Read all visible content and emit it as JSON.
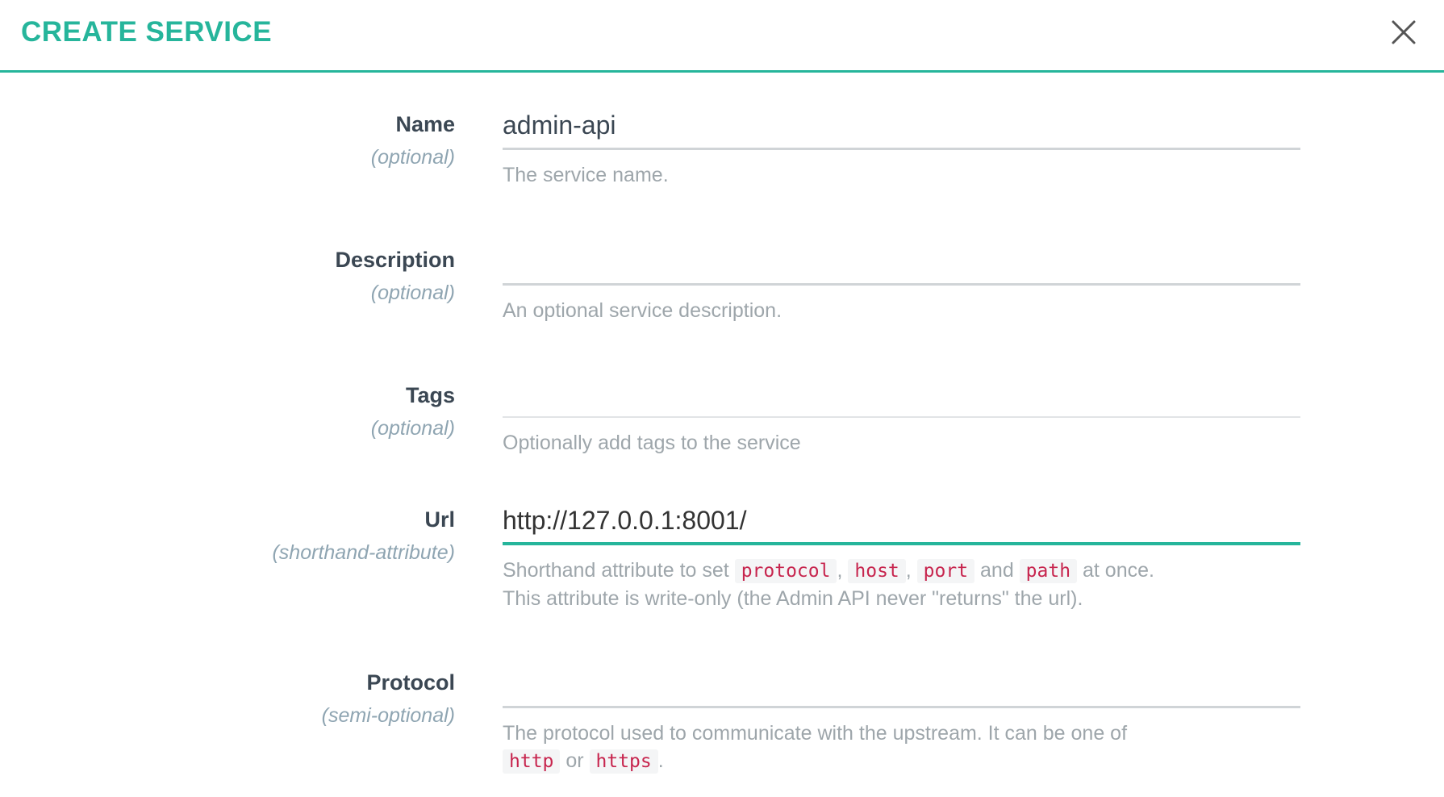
{
  "dialog": {
    "title": "CREATE SERVICE",
    "close_icon": "close-icon"
  },
  "colors": {
    "accent": "#26b59b",
    "label": "#3b4753",
    "qualifier": "#8fa5b2",
    "help": "#9ea6ab",
    "code": "#c7254e"
  },
  "fields": {
    "name": {
      "label": "Name",
      "qualifier": "(optional)",
      "value": "admin-api",
      "help": "The service name."
    },
    "description": {
      "label": "Description",
      "qualifier": "(optional)",
      "value": "",
      "help": "An optional service description."
    },
    "tags": {
      "label": "Tags",
      "qualifier": "(optional)",
      "value": "",
      "help": "Optionally add tags to the service"
    },
    "url": {
      "label": "Url",
      "qualifier": "(shorthand-attribute)",
      "value": "http://127.0.0.1:8001/",
      "help": {
        "prefix": "Shorthand attribute to set ",
        "code1": "protocol",
        "sep1": ", ",
        "code2": "host",
        "sep2": ", ",
        "code3": "port",
        "sep3": " and ",
        "code4": "path",
        "suffix": " at once.",
        "line2": "This attribute is write-only (the Admin API never \"returns\" the url)."
      }
    },
    "protocol": {
      "label": "Protocol",
      "qualifier": "(semi-optional)",
      "value": "",
      "help": {
        "prefix": "The protocol used to communicate with the upstream. It can be one of ",
        "code1": "http",
        "sep1": " or ",
        "code2": "https",
        "suffix": "."
      }
    }
  }
}
